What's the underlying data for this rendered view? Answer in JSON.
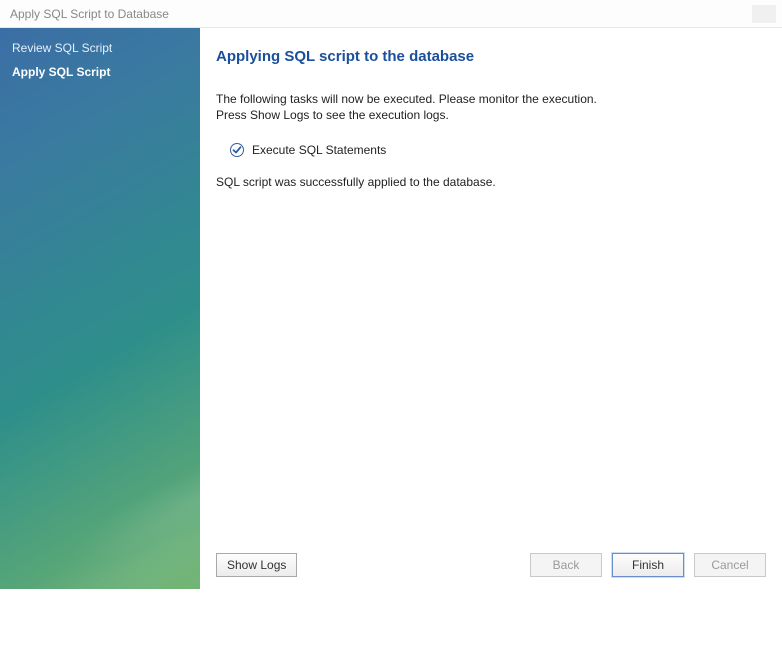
{
  "window": {
    "title": "Apply SQL Script to Database"
  },
  "sidebar": {
    "items": [
      {
        "label": "Review SQL Script",
        "active": false
      },
      {
        "label": "Apply SQL Script",
        "active": true
      }
    ]
  },
  "main": {
    "heading": "Applying SQL script to the database",
    "instruction_line1": "The following tasks will now be executed. Please monitor the execution.",
    "instruction_line2": "Press Show Logs to see the execution logs.",
    "task_label": "Execute SQL Statements",
    "status_message": "SQL script was successfully applied to the database."
  },
  "buttons": {
    "show_logs": "Show Logs",
    "back": "Back",
    "finish": "Finish",
    "cancel": "Cancel"
  }
}
